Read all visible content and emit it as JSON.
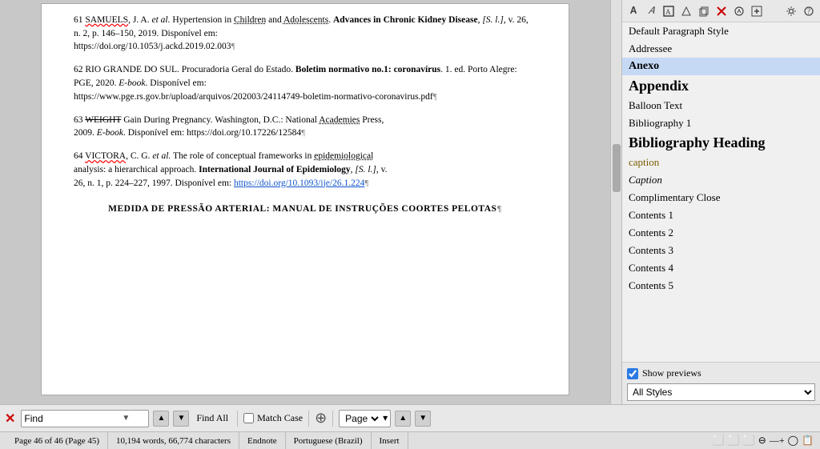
{
  "document": {
    "references": [
      {
        "id": "61",
        "text_html": "61 SAMUELS, J. A. <em>et al.</em> Hypertension in Children and Adolescents. <strong>Advances in Chronic Kidney Disease</strong>, <em>[S. l.]</em>, v. 26, n. 2, p. 146–150, 2019. Disponível em: https://doi.org/10.1053/j.ackd.2019.02.003¶"
      },
      {
        "id": "62",
        "text_html": "62 RIO GRANDE DO SUL. Procuradoria Geral do Estado. <strong>Boletim normativo no.1: coronavírus</strong>. 1. ed. Porto Alegre: PGE, 2020. <em>E-book</em>. Disponível em: https://www.pge.rs.gov.br/upload/arquivos/202003/24114749-boletim-normativo-coronavirus.pdf¶"
      },
      {
        "id": "63",
        "text_html": "63 WEIGHT Gain During Pregnancy. Washington, D.C.: National Academies Press, 2009. <em>E-book</em>. Disponível em: https://doi.org/10.17226/12584¶"
      },
      {
        "id": "64",
        "text_html": "64 VICTORA, C. G. <em>et al.</em> The role of conceptual frameworks in epidemiological analysis: a hierarchical approach. <strong>International Journal of Epidemiology</strong>, <em>[S. l.]</em>, v. 26, n. 1, p. 224–227, 1997. Disponível em: <a href='#'>https://doi.org/10.1093/ije/26.1.224</a>¶"
      }
    ],
    "centered_title": "MEDIDA DE PRESSÃO ARTERIAL: MANUAL DE INSTRUÇÕES COORTES PELOTAS¶"
  },
  "styles_panel": {
    "toolbar_icons": [
      "A",
      "A",
      "◻",
      "◻",
      "◻",
      "◻",
      "◯",
      "◻"
    ],
    "right_icons": [
      "◻",
      "◻"
    ],
    "items": [
      {
        "id": "default-paragraph",
        "label": "Default Paragraph Style",
        "style_class": ""
      },
      {
        "id": "addressee",
        "label": "Addressee",
        "style_class": ""
      },
      {
        "id": "anexo",
        "label": "Anexo",
        "style_class": "anexo-style",
        "active": true
      },
      {
        "id": "appendix",
        "label": "Appendix",
        "style_class": "appendix-style"
      },
      {
        "id": "balloon-text",
        "label": "Balloon Text",
        "style_class": ""
      },
      {
        "id": "bibliography-1",
        "label": "Bibliography 1",
        "style_class": ""
      },
      {
        "id": "bibliography-heading",
        "label": "Bibliography Heading",
        "style_class": "bib-heading-style"
      },
      {
        "id": "caption",
        "label": "caption",
        "style_class": "caption-style"
      },
      {
        "id": "caption-formal",
        "label": "Caption",
        "style_class": "italic-style"
      },
      {
        "id": "complimentary-close",
        "label": "Complimentary Close",
        "style_class": ""
      },
      {
        "id": "contents-1",
        "label": "Contents 1",
        "style_class": ""
      },
      {
        "id": "contents-2",
        "label": "Contents 2",
        "style_class": ""
      },
      {
        "id": "contents-3",
        "label": "Contents 3",
        "style_class": ""
      },
      {
        "id": "contents-4",
        "label": "Contents 4",
        "style_class": ""
      },
      {
        "id": "contents-5",
        "label": "Contents 5",
        "style_class": ""
      }
    ],
    "show_previews_label": "Show previews",
    "all_styles_value": "All Styles"
  },
  "find_bar": {
    "close_label": "✕",
    "find_label": "Find",
    "find_placeholder": "Find",
    "find_all_label": "Find All",
    "match_case_label": "Match Case",
    "other_icon": "⊕",
    "page_label": "Page",
    "nav_up": "▲",
    "nav_down": "▼",
    "prev_label": "▲",
    "next_label": "▼"
  },
  "status_bar": {
    "page_info": "Page 46 of 46 (Page 45)",
    "word_count": "10,194 words, 66,774 characters",
    "section": "Endnote",
    "language": "Portuguese (Brazil)",
    "mode": "Insert",
    "extra": ""
  }
}
